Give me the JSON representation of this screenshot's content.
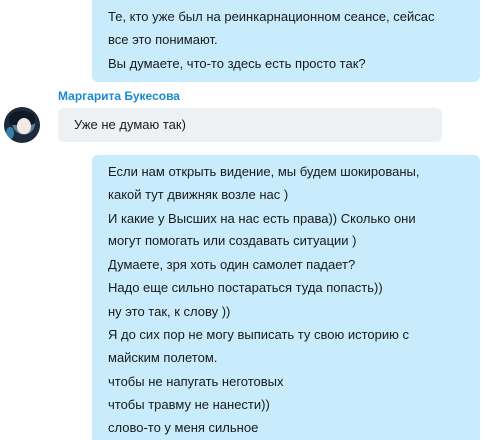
{
  "messages_top": [
    "Те, кто уже был на реинкарнационном сеансе, сейсас",
    "все это понимают.",
    "Вы думаете, что-то здесь есть просто так?"
  ],
  "incoming": {
    "sender": "Маргарита Букесова",
    "avatar_icon": "user-avatar",
    "text": "Уже не думаю так)"
  },
  "messages_bottom": [
    "Если нам открыть видение, мы будем шокированы,",
    "какой тут движняк возле нас )",
    "И какие у Высших на нас есть права)) Сколько они",
    "могут помогать или создавать ситуации )",
    "Думаете, зря хоть один самолет падает?",
    "Надо еще сильно постараться туда попасть))",
    "ну это так, к слову ))",
    "Я до сих пор не могу выписать ту свою историю с",
    "майским полетом.",
    "чтобы не напугать неготовых",
    "чтобы травму не нанести))",
    "слово-то у меня сильное"
  ],
  "colors": {
    "outgoing_bubble": "#c8ecfb",
    "incoming_bubble": "#edf1f4",
    "sender_name": "#1a8ad4"
  }
}
